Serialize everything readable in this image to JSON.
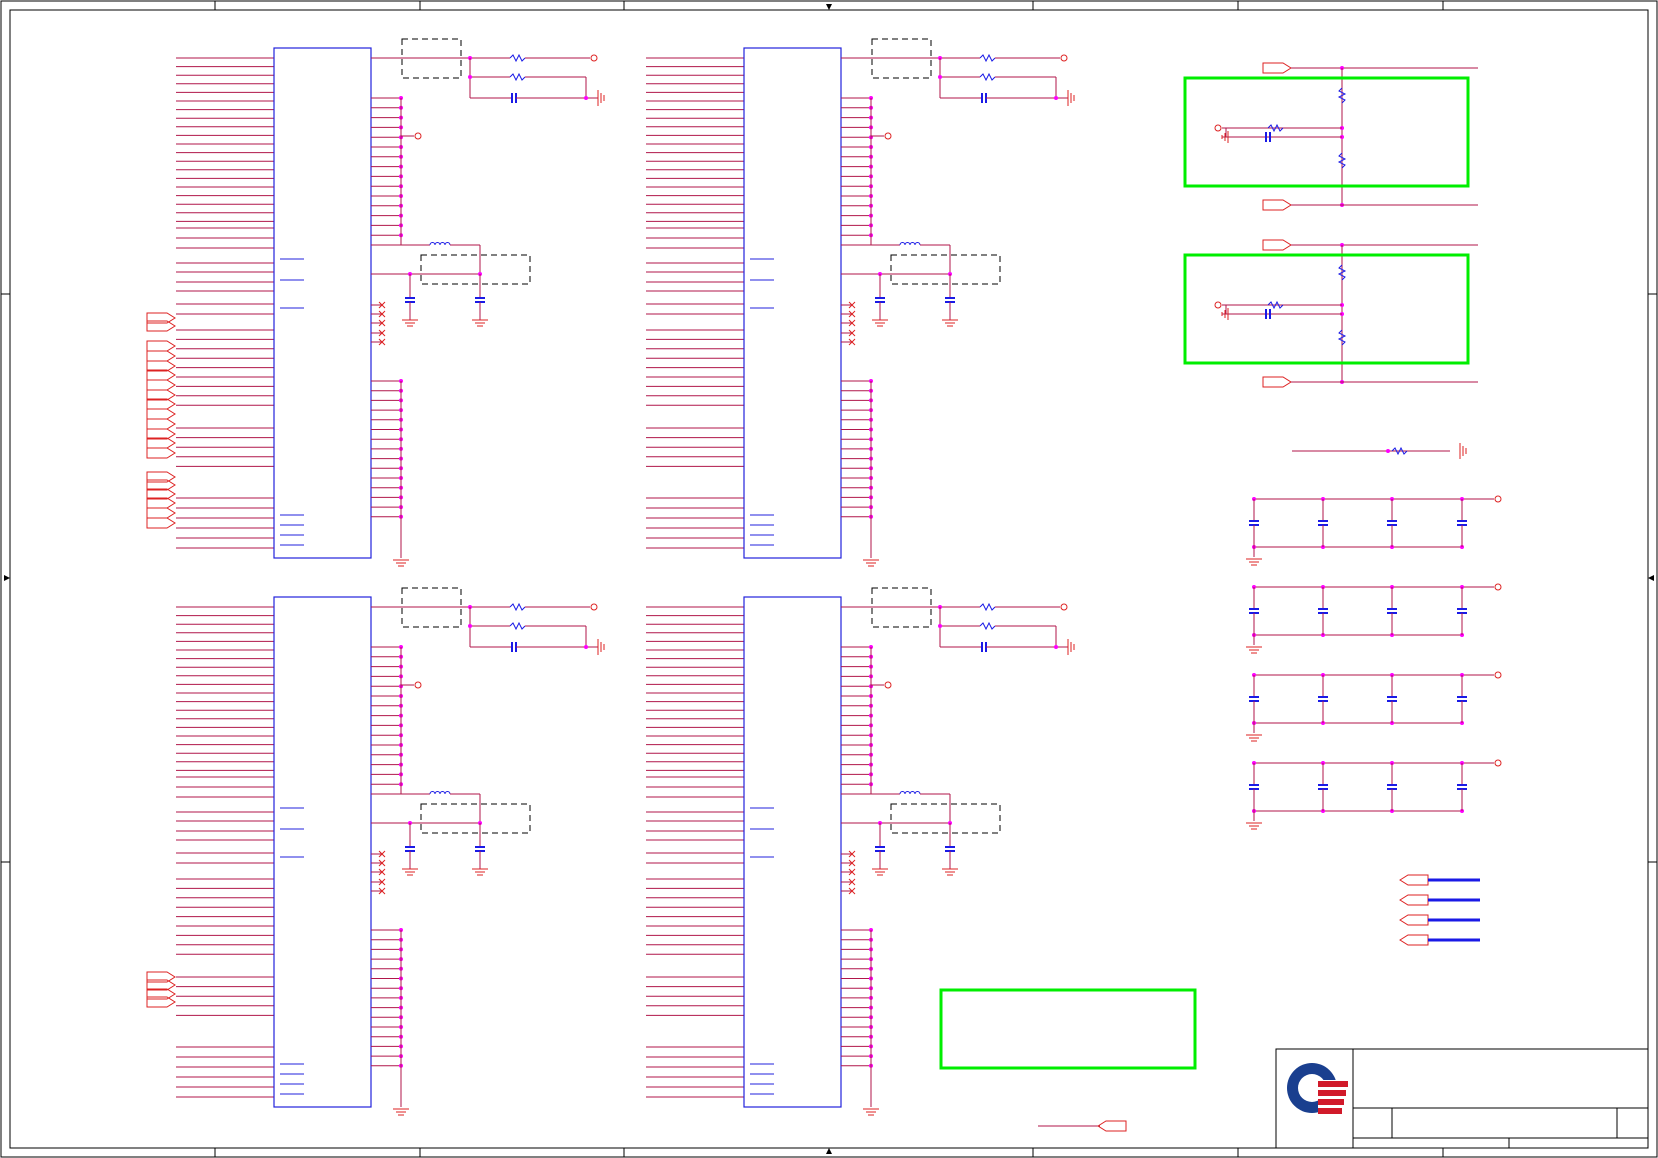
{
  "title_block": {
    "company_logo": "quanta-logo",
    "title": "",
    "size": "",
    "document_number": "",
    "rev": "",
    "date": "",
    "sheet": ""
  },
  "border": {
    "column_marker": "arrow-marker",
    "row_marker": "arrow-marker"
  },
  "colors": {
    "wire": "#b0164a",
    "net_dot": "#ff00ff",
    "ic_body": "#2222dd",
    "off_page_connector": "#dd2222",
    "highlight_box": "#00ee00",
    "bus_wire": "#1a1ae6",
    "border": "#000000"
  },
  "components": {
    "ic_count": 4,
    "ic_symbol": "ic-body",
    "resistor_symbol": "resistor-icon",
    "capacitor_symbol": "capacitor-icon",
    "inductor_symbol": "inductor-icon",
    "ground_symbol": "ground-icon",
    "power_symbol": "power-pin-icon",
    "no_connect_symbol": "no-connect-icon",
    "offpage_symbol": "off-page-connector-icon"
  }
}
